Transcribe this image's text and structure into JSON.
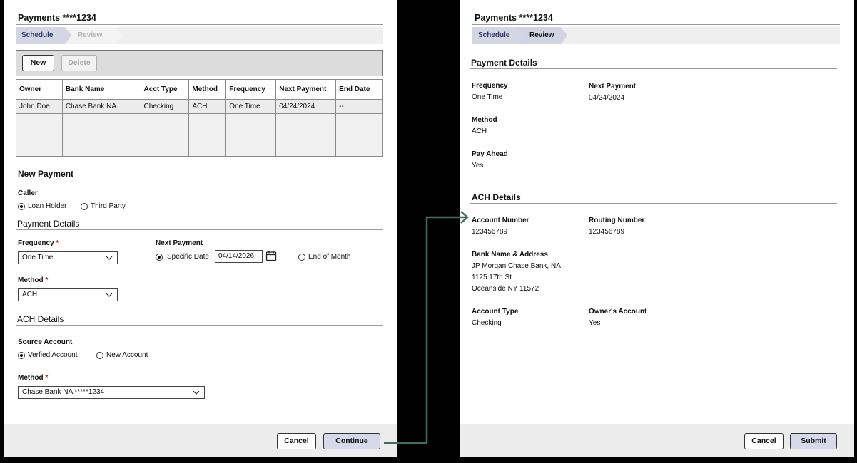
{
  "left": {
    "title": "Payments ****1234",
    "steps": {
      "schedule": "Schedule",
      "review": "Review"
    },
    "toolbar": {
      "new_label": "New",
      "delete_label": "Delete"
    },
    "table": {
      "headers": [
        "Owner",
        "Bank Name",
        "Acct Type",
        "Method",
        "Frequency",
        "Next Payment",
        "End Date"
      ],
      "rows": [
        [
          "John Doe",
          "Chase Bank NA",
          "Checking",
          "ACH",
          "One Time",
          "04/24/2024",
          "--"
        ]
      ]
    },
    "new_payment": {
      "heading": "New Payment",
      "caller_label": "Caller",
      "caller_options": [
        "Loan Holder",
        "Third Party"
      ],
      "caller_selected": "Loan Holder"
    },
    "payment_details": {
      "heading": "Payment Details",
      "frequency_label": "Frequency",
      "frequency_value": "One Time",
      "next_payment_label": "Next Payment",
      "specific_date_label": "Specific Date",
      "specific_date_value": "04/14/2026",
      "end_of_month_label": "End of Month",
      "method_label": "Method",
      "method_value": "ACH",
      "required_mark": "*"
    },
    "ach_details": {
      "heading": "ACH Details",
      "source_account_label": "Source Account",
      "source_options": [
        "Verfied Account",
        "New Account"
      ],
      "source_selected": "Verfied Account",
      "method_label": "Method",
      "method_value": "Chase Bank NA *****1234"
    },
    "footer": {
      "cancel_label": "Cancel",
      "continue_label": "Continue"
    }
  },
  "right": {
    "title": "Payments ****1234",
    "steps": {
      "schedule": "Schedule",
      "review": "Review"
    },
    "payment_details": {
      "heading": "Payment Details",
      "frequency_label": "Frequency",
      "frequency_value": "One Time",
      "next_payment_label": "Next Payment",
      "next_payment_value": "04/24/2024",
      "method_label": "Method",
      "method_value": "ACH",
      "pay_ahead_label": "Pay Ahead",
      "pay_ahead_value": "Yes"
    },
    "ach_details": {
      "heading": "ACH Details",
      "account_number_label": "Account Number",
      "account_number_value": "123456789",
      "routing_number_label": "Routing Number",
      "routing_number_value": "123456789",
      "bank_name_label": "Bank Name & Address",
      "bank_name_line1": "JP Morgan Chase Bank, NA",
      "bank_name_line2": "1125 17th St",
      "bank_name_line3": "Oceanside NY 11572",
      "account_type_label": "Account Type",
      "account_type_value": "Checking",
      "owners_account_label": "Owner's Account",
      "owners_account_value": "Yes"
    },
    "footer": {
      "cancel_label": "Cancel",
      "submit_label": "Submit"
    }
  },
  "colors": {
    "connector": "#3f6e5a",
    "primary_button": "#d5d9ea",
    "required": "#c81e1e"
  },
  "icons": [
    "chevron-down-icon",
    "calendar-icon",
    "arrow-right-icon"
  ]
}
